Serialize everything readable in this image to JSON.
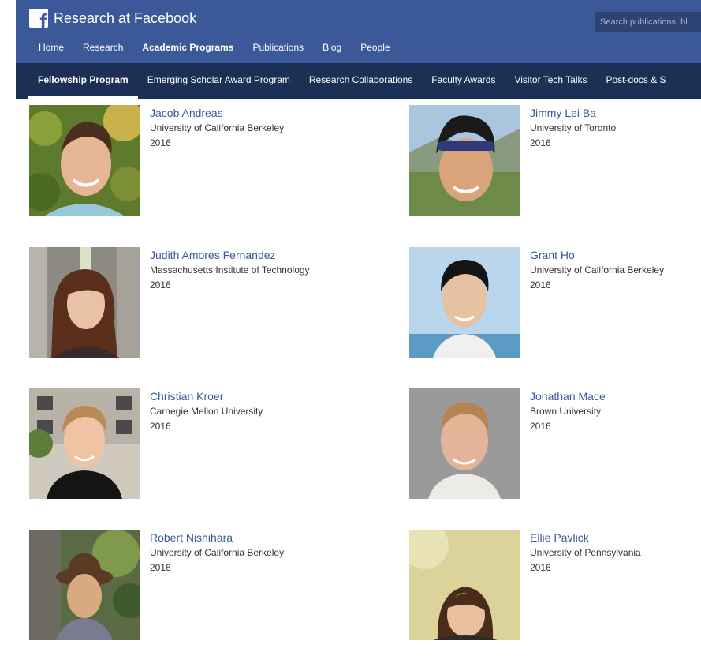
{
  "header": {
    "site_title": "Research at Facebook",
    "logo_letter": "f",
    "search_placeholder": "Search publications, bl",
    "nav": [
      "Home",
      "Research",
      "Academic Programs",
      "Publications",
      "Blog",
      "People"
    ],
    "nav_active": "Academic Programs"
  },
  "subnav": {
    "items": [
      "Fellowship Program",
      "Emerging Scholar Award Program",
      "Research Collaborations",
      "Faculty Awards",
      "Visitor Tech Talks",
      "Post-docs & S"
    ],
    "active": "Fellowship Program"
  },
  "fellows": [
    {
      "name": "Jacob Andreas",
      "school": "University of California Berkeley",
      "year": "2016"
    },
    {
      "name": "Jimmy Lei Ba",
      "school": "University of Toronto",
      "year": "2016"
    },
    {
      "name": "Judith Amores Fernandez",
      "school": "Massachusetts Institute of Technology",
      "year": "2016"
    },
    {
      "name": "Grant Ho",
      "school": "University of California Berkeley",
      "year": "2016"
    },
    {
      "name": "Christian Kroer",
      "school": "Carnegie Mellon University",
      "year": "2016"
    },
    {
      "name": "Jonathan Mace",
      "school": "Brown University",
      "year": "2016"
    },
    {
      "name": "Robert Nishihara",
      "school": "University of California Berkeley",
      "year": "2016"
    },
    {
      "name": "Ellie Pavlick",
      "school": "University of Pennsylvania",
      "year": "2016"
    }
  ],
  "colors": {
    "brand_blue": "#3b5998",
    "subnav_navy": "#1c2f55",
    "link_blue": "#3b5998"
  }
}
